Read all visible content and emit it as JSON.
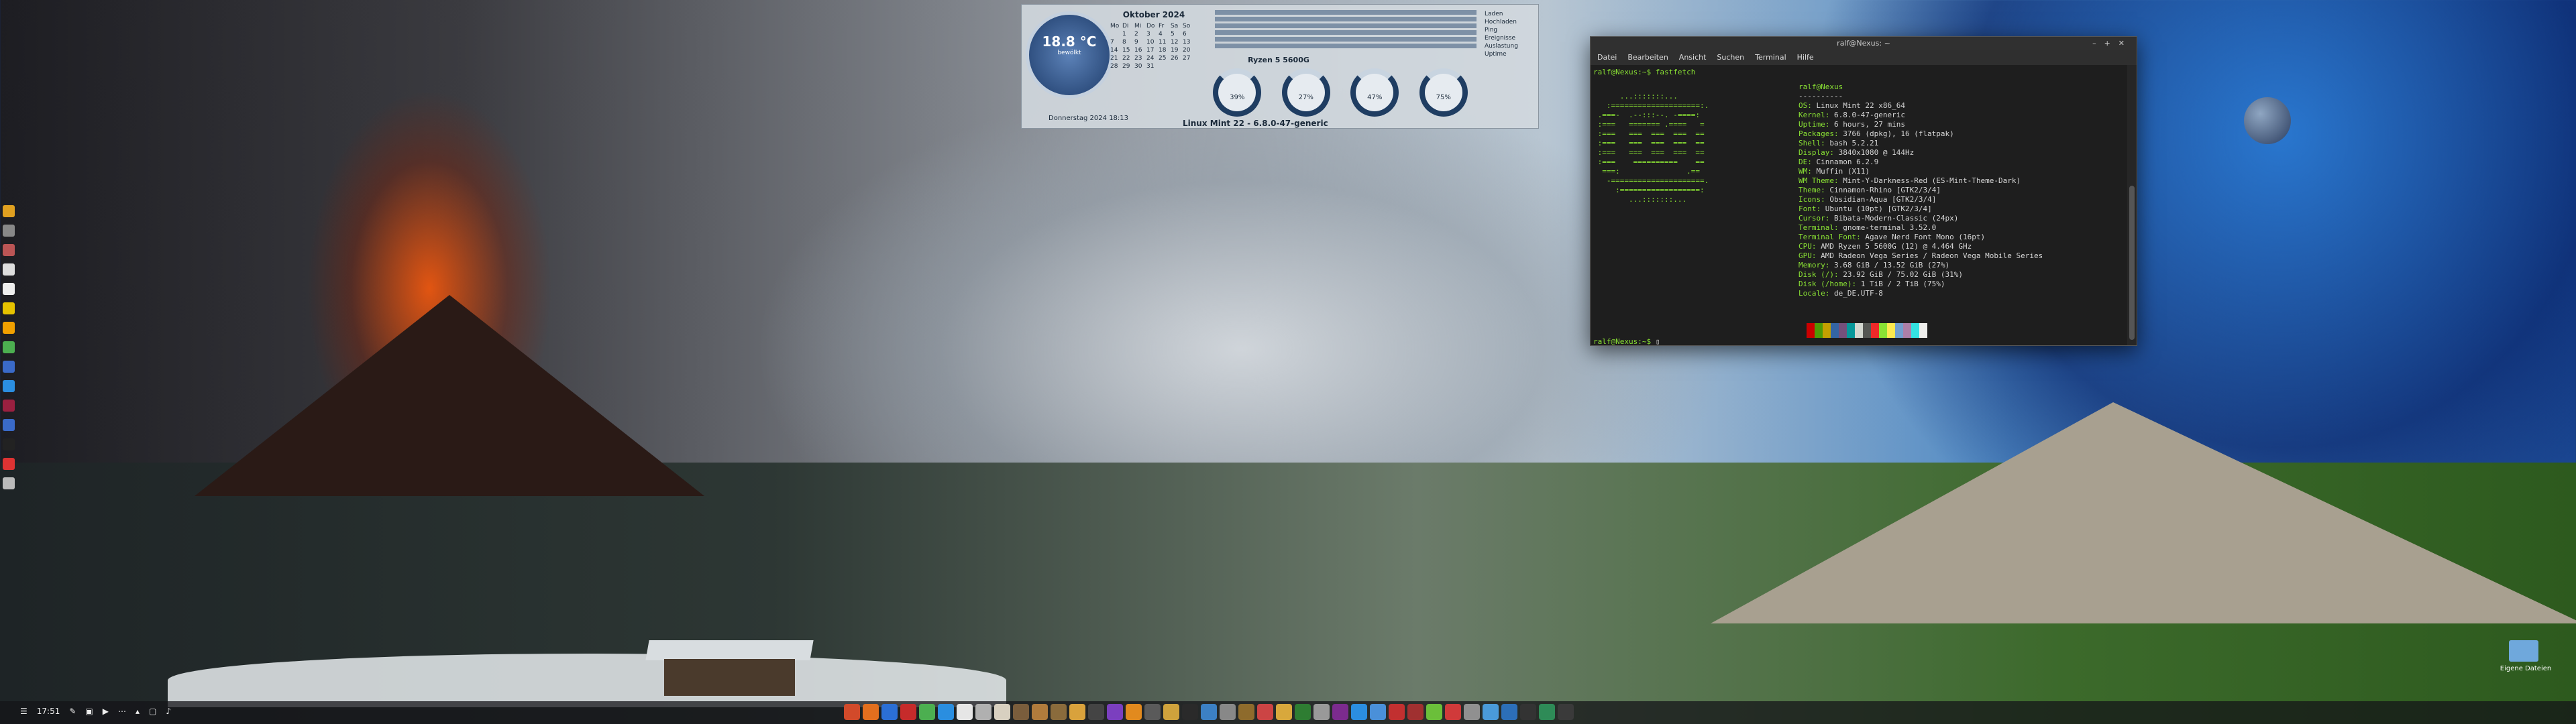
{
  "conky": {
    "calendar": {
      "month": "Oktober 2024",
      "weekdays": [
        "Mo",
        "Di",
        "Mi",
        "Do",
        "Fr",
        "Sa",
        "So"
      ],
      "days": [
        "",
        "1",
        "2",
        "3",
        "4",
        "5",
        "6",
        "7",
        "8",
        "9",
        "10",
        "11",
        "12",
        "13",
        "14",
        "15",
        "16",
        "17",
        "18",
        "19",
        "20",
        "21",
        "22",
        "23",
        "24",
        "25",
        "26",
        "27",
        "28",
        "29",
        "30",
        "31",
        "",
        "",
        ""
      ]
    },
    "weather": {
      "temp": "18.8 °C",
      "desc": "bewölkt"
    },
    "cpu_name": "Ryzen 5 5600G",
    "os_line": "Linux Mint 22 - 6.8.0-47-generic",
    "gauges": [
      "39%",
      "27%",
      "47%",
      "75%"
    ],
    "net": {
      "lines": [
        "Laden",
        "Hochladen",
        "Ping",
        "Ereignisse",
        "Auslastung",
        "Uptime"
      ]
    },
    "clock": "18:13",
    "date_left": "Donnerstag 2024"
  },
  "terminal": {
    "title": "ralf@Nexus: ~",
    "menu": [
      "Datei",
      "Bearbeiten",
      "Ansicht",
      "Suchen",
      "Terminal",
      "Hilfe"
    ],
    "prompt1": "ralf@Nexus:~$ fastfetch",
    "user_host": "ralf@Nexus",
    "separator": "----------",
    "info": [
      {
        "k": "OS:",
        "v": " Linux Mint 22 x86_64"
      },
      {
        "k": "Kernel:",
        "v": " 6.8.0-47-generic"
      },
      {
        "k": "Uptime:",
        "v": " 6 hours, 27 mins"
      },
      {
        "k": "Packages:",
        "v": " 3766 (dpkg), 16 (flatpak)"
      },
      {
        "k": "Shell:",
        "v": " bash 5.2.21"
      },
      {
        "k": "Display:",
        "v": " 3840x1080 @ 144Hz"
      },
      {
        "k": "DE:",
        "v": " Cinnamon 6.2.9"
      },
      {
        "k": "WM:",
        "v": " Muffin (X11)"
      },
      {
        "k": "WM Theme:",
        "v": " Mint-Y-Darkness-Red (ES-Mint-Theme-Dark)"
      },
      {
        "k": "Theme:",
        "v": " Cinnamon-Rhino [GTK2/3/4]"
      },
      {
        "k": "Icons:",
        "v": " Obsidian-Aqua [GTK2/3/4]"
      },
      {
        "k": "Font:",
        "v": " Ubuntu (10pt) [GTK2/3/4]"
      },
      {
        "k": "Cursor:",
        "v": " Bibata-Modern-Classic (24px)"
      },
      {
        "k": "Terminal:",
        "v": " gnome-terminal 3.52.0"
      },
      {
        "k": "Terminal Font:",
        "v": " Agave Nerd Font Mono (16pt)"
      },
      {
        "k": "CPU:",
        "v": " AMD Ryzen 5 5600G (12) @ 4.464 GHz"
      },
      {
        "k": "GPU:",
        "v": " AMD Radeon Vega Series / Radeon Vega Mobile Series"
      },
      {
        "k": "Memory:",
        "v": " 3.68 GiB / 13.52 GiB (27%)"
      },
      {
        "k": "Disk (/):",
        "v": " 23.92 GiB / 75.02 GiB (31%)"
      },
      {
        "k": "Disk (/home):",
        "v": " 1 TiB / 2 TiB (75%)"
      },
      {
        "k": "Locale:",
        "v": " de_DE.UTF-8"
      }
    ],
    "prompt2": "ralf@Nexus:~$ ",
    "swatch_colors": [
      "#1e1e1e",
      "#cc0000",
      "#4e9a06",
      "#c4a000",
      "#3465a4",
      "#75507b",
      "#06989a",
      "#d3d7cf",
      "#555753",
      "#ef2929",
      "#8ae234",
      "#fce94f",
      "#729fcf",
      "#ad7fa8",
      "#34e2e2",
      "#eeeeec"
    ]
  },
  "panel": {
    "time": "17:51",
    "app_colors": [
      "#d24a2a",
      "#e36f1e",
      "#2b6fd6",
      "#c62b2b",
      "#4caf50",
      "#2a8ee0",
      "#e6e6e6",
      "#b0b0b0",
      "#d8d0c0",
      "#7a5d3c",
      "#b07b3c",
      "#8a6b3c",
      "#d9a23c",
      "#444",
      "#7b3fbf",
      "#e28a1e",
      "#5a5a5a",
      "#cfa23c",
      "#2a2a2a",
      "#3c80c4",
      "#888",
      "#8e6b2c",
      "#c44",
      "#d8a83c",
      "#2e7d32",
      "#999",
      "#7c2b8e",
      "#2b8ee0",
      "#4a90d9",
      "#c23030",
      "#a03030",
      "#6bbf3a",
      "#d03a3a",
      "#909090",
      "#4a9ad9",
      "#2c6fb8",
      "#333",
      "#2e8b57",
      "#3a3a3a"
    ]
  },
  "desktop": {
    "folder_label": "Eigene Dateien"
  }
}
